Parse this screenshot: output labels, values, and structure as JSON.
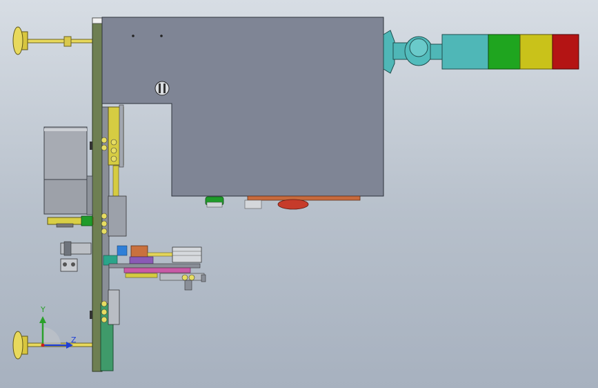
{
  "viewport": {
    "background_top": "#d7dde4",
    "background_bottom": "#a7b1bf"
  },
  "triad": {
    "y_label": "Y",
    "z_label": "Z",
    "y_color": "#2aa02a",
    "z_color": "#1f3fd6",
    "x_color": "#c81f1f"
  },
  "colors": {
    "main_plate": "#6e7f52",
    "housing": "#7f8595",
    "feet": "#e3d35a",
    "stack_light_body": "#4fb7b7",
    "stack_light_green": "#1fa51f",
    "stack_light_yellow": "#c9c21a",
    "stack_light_red": "#b41414",
    "motor": "#a7abb3"
  }
}
